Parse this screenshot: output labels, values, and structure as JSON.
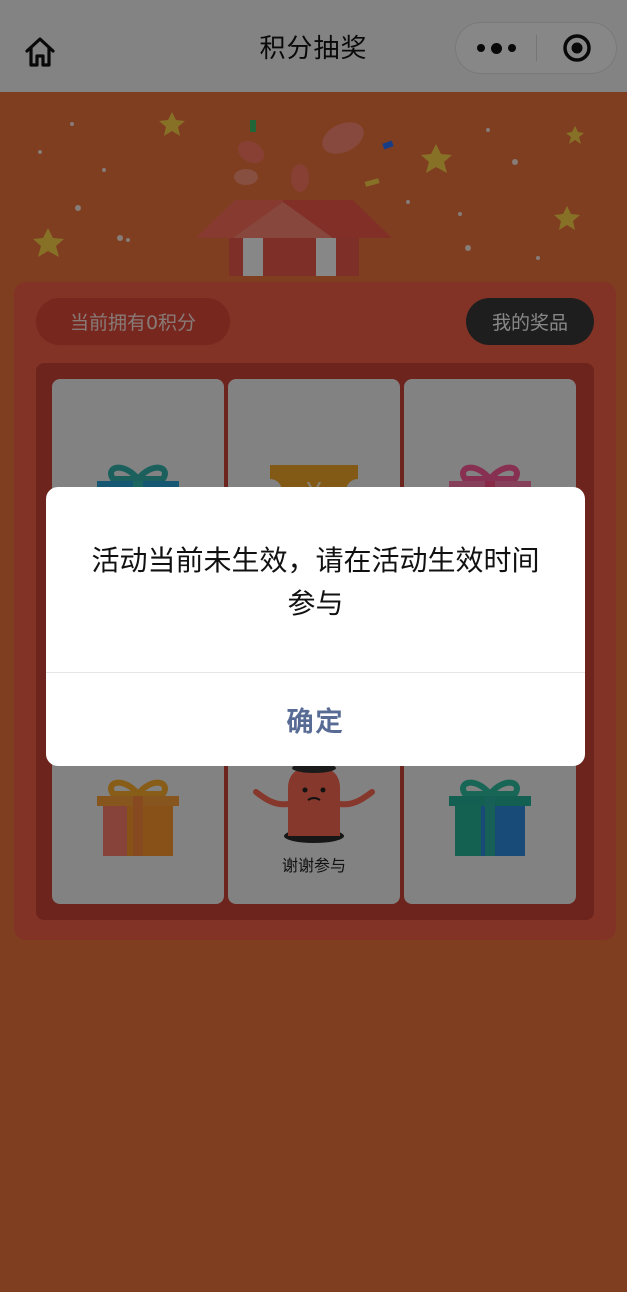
{
  "header": {
    "title": "积分抽奖",
    "home_icon": "home-icon",
    "more_icon": "more-dots-icon",
    "close_icon": "target-close-icon"
  },
  "panel": {
    "points_label": "当前拥有0积分",
    "my_prizes_label": "我的奖品"
  },
  "grid": {
    "cells": [
      {
        "icon": "gift-blue-icon",
        "label": ""
      },
      {
        "icon": "coupon-yen-icon",
        "label": ""
      },
      {
        "icon": "gift-pink-icon",
        "label": ""
      },
      {
        "icon": "gift-orange-icon",
        "label": ""
      },
      {
        "icon": "mascot-icon",
        "label": "谢谢参与"
      },
      {
        "icon": "gift-teal-icon",
        "label": ""
      }
    ]
  },
  "dialog": {
    "message": "活动当前未生效，请在活动生效时间参与",
    "confirm_label": "确定"
  },
  "colors": {
    "page_bg": "#f2753f",
    "panel_bg": "#f86048",
    "dialog_button": "#576b95"
  }
}
